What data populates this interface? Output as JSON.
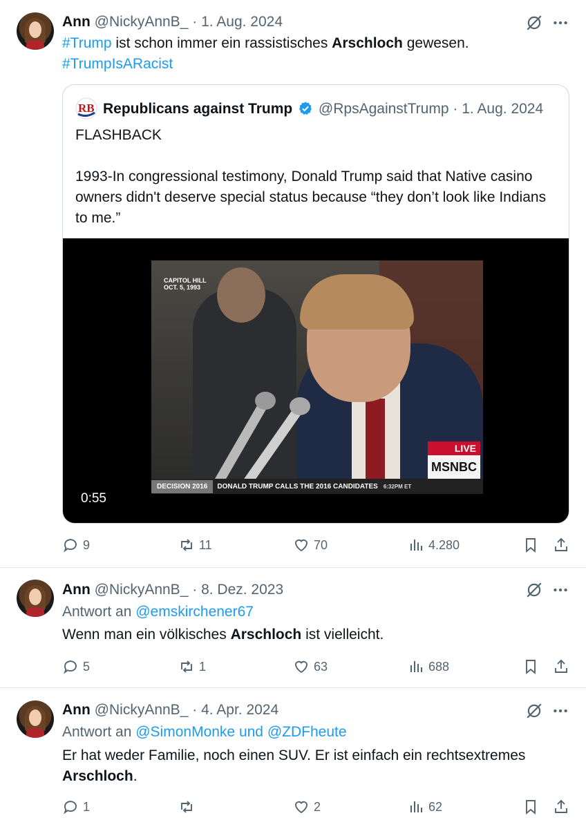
{
  "tweets": [
    {
      "author": "Ann",
      "handle": "@NickyAnnB_",
      "sep": "·",
      "date": "1. Aug. 2024",
      "text_parts": [
        "#Trump",
        " ist schon immer ein rassistisches ",
        "Arschloch",
        " gewesen."
      ],
      "hashtag2": "#TrumpIsARacist",
      "quote": {
        "author": "Republicans against Trump",
        "handle": "@RpsAgainstTrump",
        "sep": "·",
        "date": "1. Aug. 2024",
        "logo_text": "RB",
        "line1": "FLASHBACK",
        "line2": "1993-In congressional testimony, Donald Trump said that Native casino owners didn't deserve special status because “they don’t look like Indians to me.”",
        "video": {
          "duration": "0:55",
          "overlay_tl": "CAPITOL HILL\nOCT. 5, 1993",
          "live": "LIVE",
          "network": "MSNBC",
          "ticker_left": "DECISION 2016",
          "ticker_main": "DONALD TRUMP CALLS THE 2016 CANDIDATES",
          "ticker_time": "6:32PM ET"
        }
      },
      "stats": {
        "replies": "9",
        "reposts": "11",
        "likes": "70",
        "views": "4.280"
      }
    },
    {
      "author": "Ann",
      "handle": "@NickyAnnB_",
      "sep": "·",
      "date": "8. Dez. 2023",
      "reply_prefix": "Antwort an ",
      "reply_to": "@emskirchener67",
      "text_parts": [
        "Wenn man ein völkisches ",
        "Arschloch",
        " ist vielleicht."
      ],
      "stats": {
        "replies": "5",
        "reposts": "1",
        "likes": "63",
        "views": "688"
      }
    },
    {
      "author": "Ann",
      "handle": "@NickyAnnB_",
      "sep": "·",
      "date": "4. Apr. 2024",
      "reply_prefix": "Antwort an ",
      "reply_to": "@SimonMonke",
      "reply_and": " und ",
      "reply_to2": "@ZDFheute",
      "text_parts": [
        "Er hat weder Familie, noch einen SUV. Er ist einfach ein rechtsextremes ",
        "Arschloch",
        "."
      ],
      "stats": {
        "replies": "1",
        "reposts": "",
        "likes": "2",
        "views": "62"
      }
    }
  ],
  "colors": {
    "link": "#1d9bf0",
    "muted": "#536471",
    "text": "#0f1419",
    "border": "#e6e9ec"
  }
}
